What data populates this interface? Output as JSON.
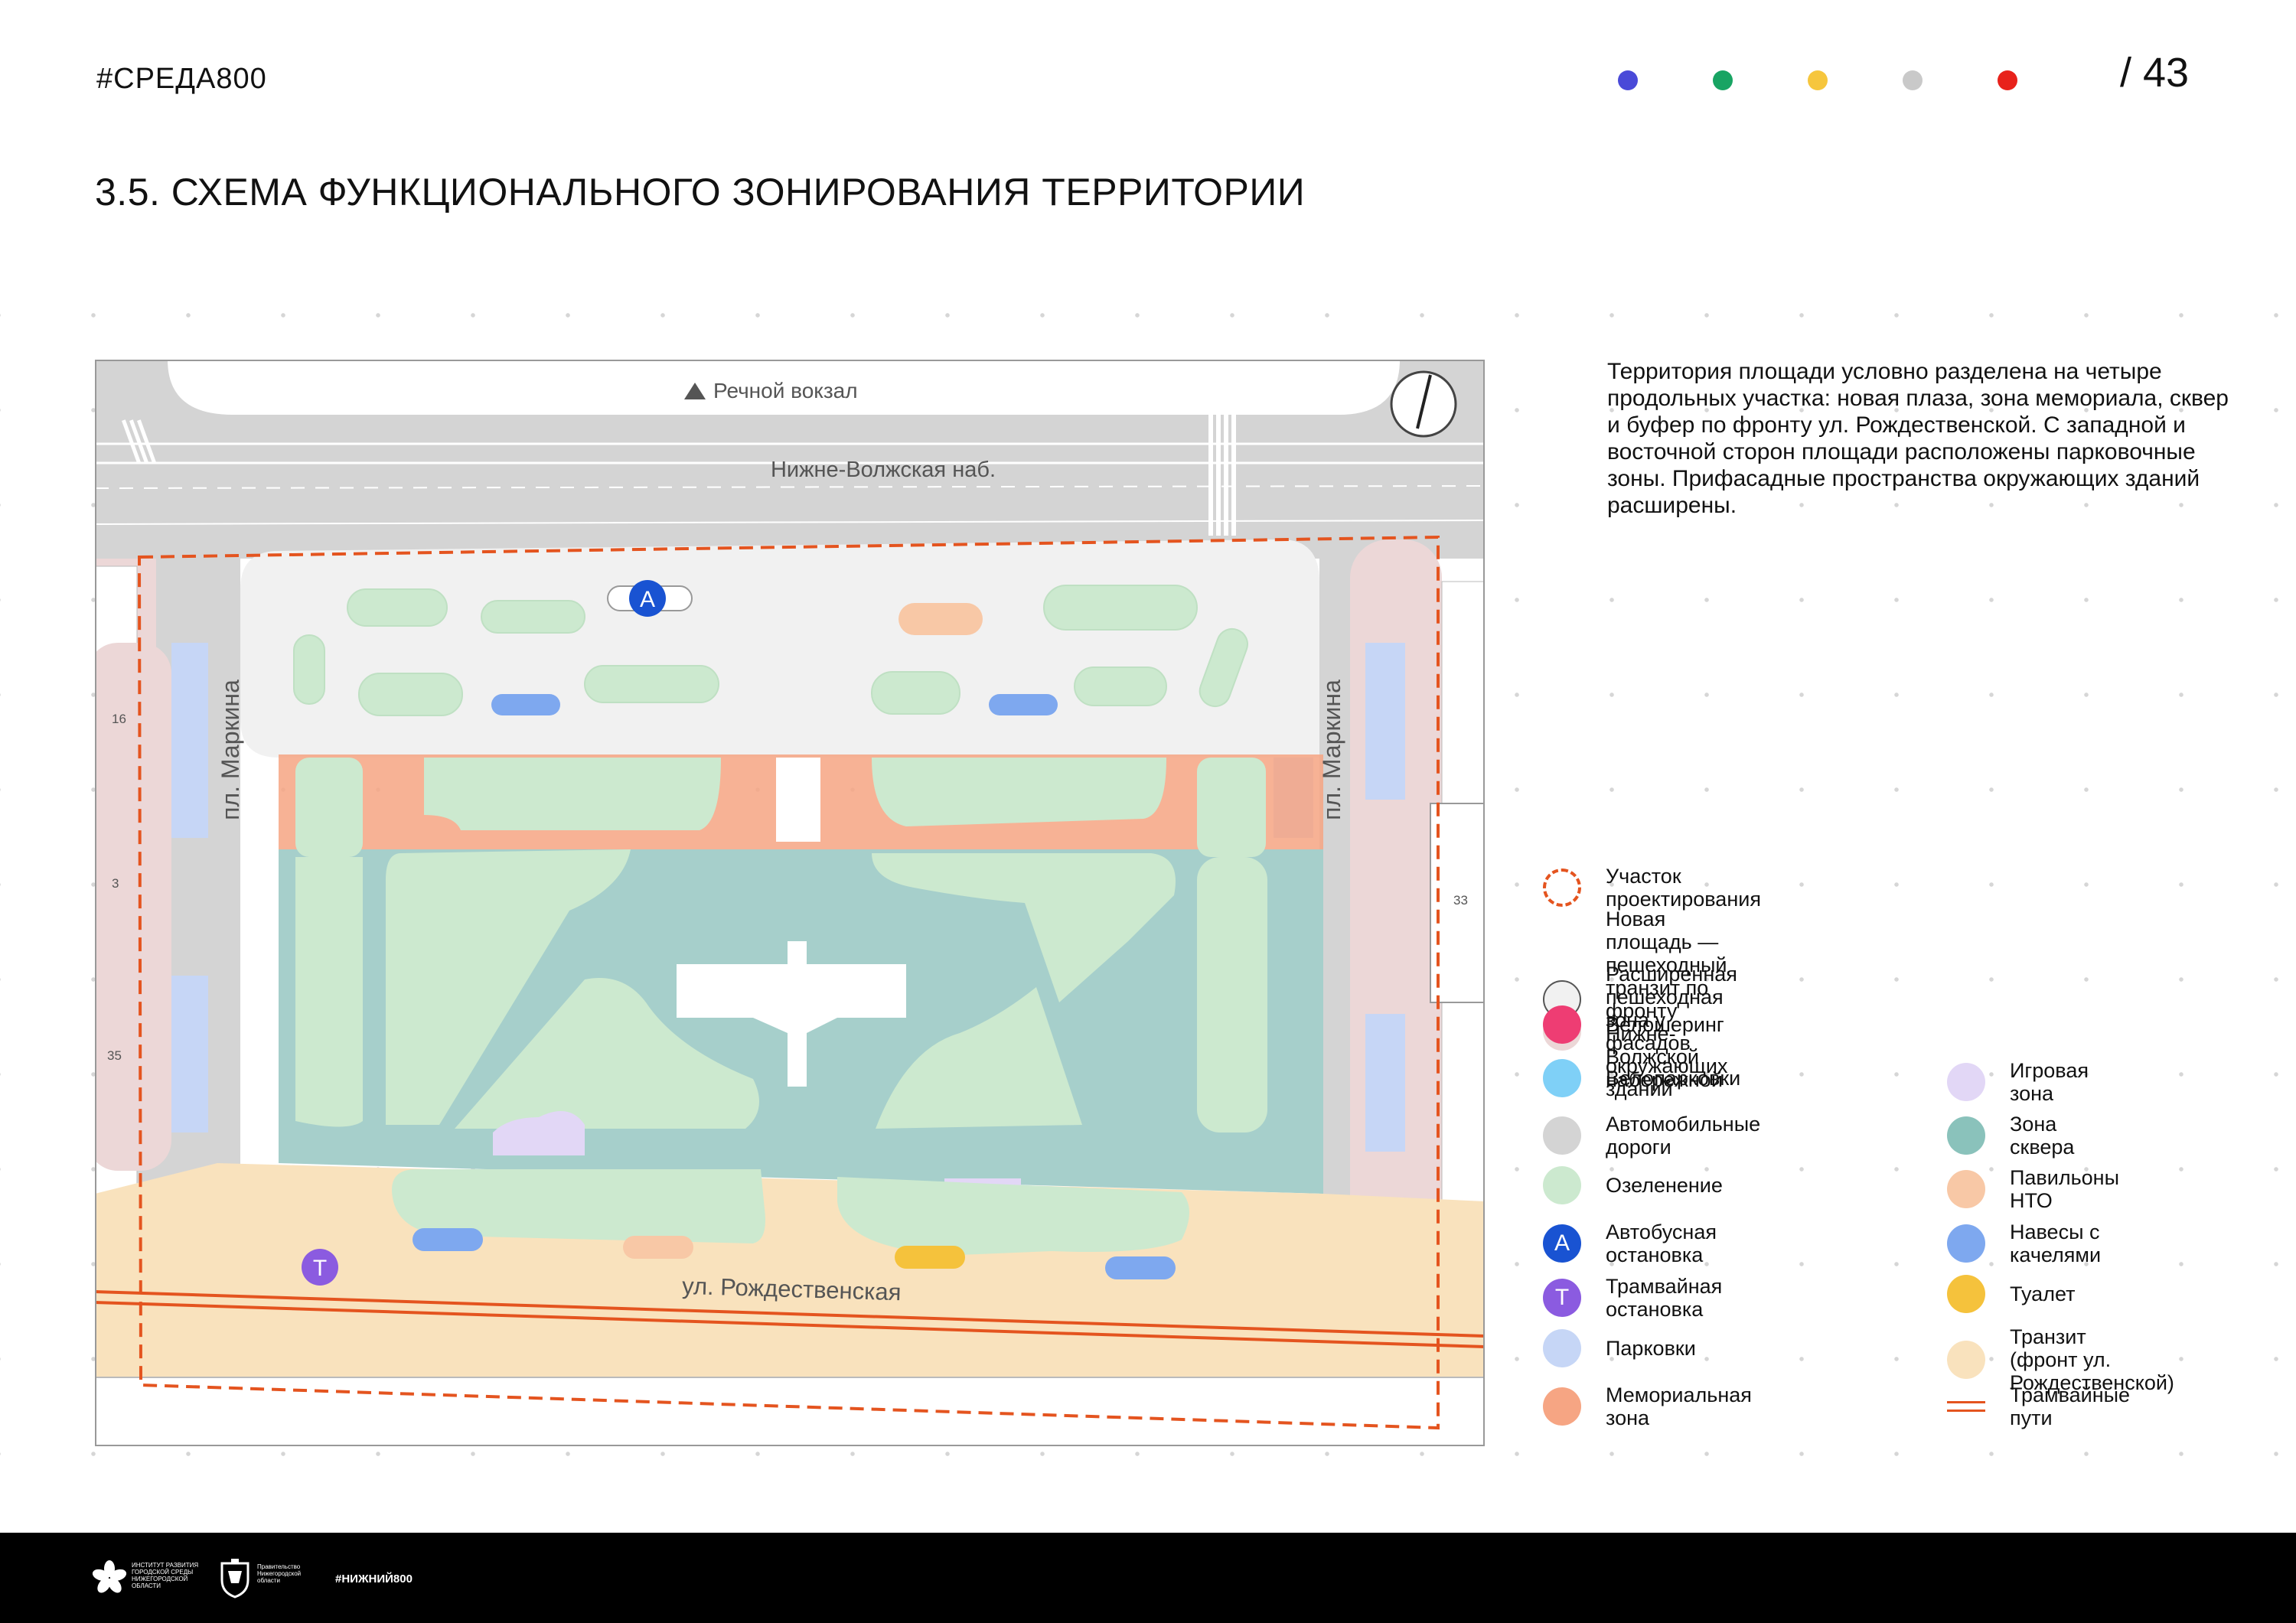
{
  "header": {
    "brand": "#СРЕДА800",
    "page_number": "/ 43",
    "palette": [
      "#4a4ad8",
      "#18a463",
      "#f6c63d",
      "#c9c9c9",
      "#e8221b"
    ]
  },
  "title": "3.5. СХЕМА ФУНКЦИОНАЛЬНОГО ЗОНИРОВАНИЯ ТЕРРИТОРИИ",
  "description": "Территория площади условно разделена на четыре продольных участка: новая плаза, зона мемориала, сквер и буфер по фронту ул. Рождественской. С западной и восточной сторон площади расположены парковочные зоны. Прифасадные пространства окружающих зданий расширены.",
  "map": {
    "labels": {
      "river_station": "Речной вокзал",
      "embankment": "Нижне-Волжская наб.",
      "markin_west": "пл. Маркина",
      "markin_east": "пл. Маркина",
      "rozhdestvenskaya": "ул. Рождественская",
      "bus_stop_letter": "А",
      "tram_stop_letter": "Т"
    },
    "building_numbers": [
      "16",
      "3",
      "35",
      "33"
    ]
  },
  "legend": {
    "left": [
      {
        "label": "Участок проектирования",
        "color": "#e4541f",
        "kind": "dashed"
      },
      {
        "label": "Новая площадь — пешеходный транзит по фронту\nНижне-Волжской набережной",
        "color": "#f1f1f1",
        "kind": "outlined"
      },
      {
        "label": "Расширенная пешеходная зона у\nфасадов окружающих зданий",
        "color": "#ecd7d7",
        "kind": "fill"
      },
      {
        "label": "Велошеринг",
        "color": "#ee3d73",
        "kind": "fill"
      },
      {
        "label": "Велопарковки",
        "color": "#7fd0f7",
        "kind": "fill"
      },
      {
        "label": "Автомобильные дороги",
        "color": "#d4d4d4",
        "kind": "fill"
      },
      {
        "label": "Озеленение",
        "color": "#cce9cf",
        "kind": "fill"
      },
      {
        "label": "Автобусная остановка",
        "color": "#1953d2",
        "kind": "letter",
        "letter": "А"
      },
      {
        "label": "Трамвайная остановка",
        "color": "#8b5be0",
        "kind": "letter",
        "letter": "Т"
      },
      {
        "label": "Парковки",
        "color": "#c6d6f6",
        "kind": "fill"
      },
      {
        "label": "Мемориальная зона",
        "color": "#f6a583",
        "kind": "fill"
      }
    ],
    "right": [
      {
        "label": "Игровая зона",
        "color": "#e2d7f6",
        "kind": "fill"
      },
      {
        "label": "Зона сквера",
        "color": "#8ac2bb",
        "kind": "fill"
      },
      {
        "label": "Павильоны НТО",
        "color": "#f8c8a6",
        "kind": "fill"
      },
      {
        "label": "Навесы с качелями",
        "color": "#7ea8ef",
        "kind": "fill"
      },
      {
        "label": "Туалет",
        "color": "#f5c23c",
        "kind": "fill"
      },
      {
        "label": "Транзит\n(фронт ул. Рождественской)",
        "color": "#f9e2bd",
        "kind": "fill"
      },
      {
        "label": "Трамвайные пути",
        "color": "#e4541f",
        "kind": "lines"
      }
    ]
  },
  "footer": {
    "org_text": "ИНСТИТУТ РАЗВИТИЯ ГОРОДСКОЙ СРЕДЫ НИЖЕГОРОДСКОЙ ОБЛАСТИ",
    "gov_text": "Правительство Нижегородской области",
    "hashtag": "#НИЖНИЙ800"
  }
}
